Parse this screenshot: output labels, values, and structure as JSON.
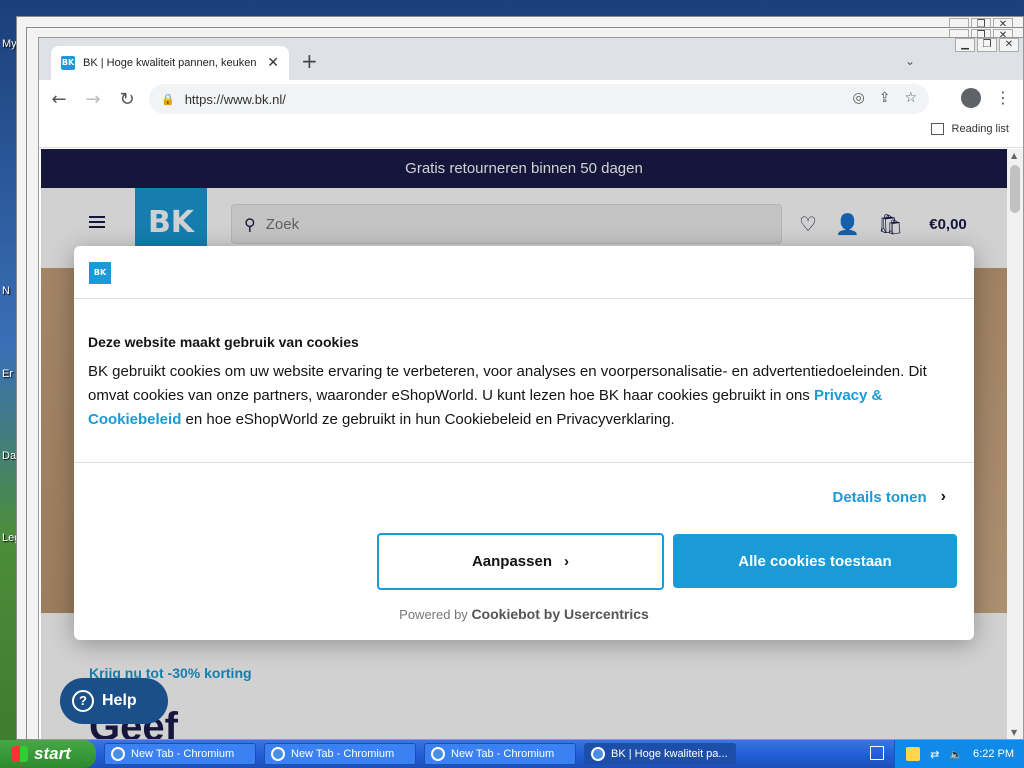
{
  "desktop": {
    "labels": [
      "My",
      "N",
      "Er",
      "Da",
      "Leg"
    ]
  },
  "browser": {
    "tab": {
      "title": "BK | Hoge kwaliteit pannen, keuken",
      "close": "✕"
    },
    "new_tab": "+",
    "address": "https://www.bk.nl/",
    "reading_list": "Reading list"
  },
  "page": {
    "promo": "Gratis retourneren binnen 50 dagen",
    "search": {
      "placeholder": "Zoek"
    },
    "cart_total": "€0,00",
    "discount": "Krijg nu tot -30% korting",
    "heading": "Geef"
  },
  "cookie": {
    "title": "Deze website maakt gebruik van cookies",
    "body_pre": "BK gebruikt cookies om uw website ervaring te verbeteren, voor analyses en voorpersonalisatie- en advertentiedoeleinden. Dit omvat cookies van onze partners, waaronder eShopWorld. U kunt lezen hoe BK haar cookies gebruikt in ons ",
    "body_link": "Privacy & Cookiebeleid",
    "body_post": " en hoe eShopWorld ze gebruikt in hun Cookiebeleid en Privacyverklaring.",
    "details": "Details tonen",
    "customize": "Aanpassen",
    "allow_all": "Alle cookies toestaan",
    "powered_by": "Powered by",
    "powered_brand": "Cookiebot by Usercentrics"
  },
  "help": {
    "label": "Help"
  },
  "taskbar": {
    "start": "start",
    "tasks": [
      "New Tab - Chromium",
      "New Tab - Chromium",
      "New Tab - Chromium",
      "BK | Hoge kwaliteit pa..."
    ],
    "time": "6:22 PM"
  },
  "colors": {
    "brand_blue": "#1a9ad6",
    "navy": "#1b1a4a"
  }
}
